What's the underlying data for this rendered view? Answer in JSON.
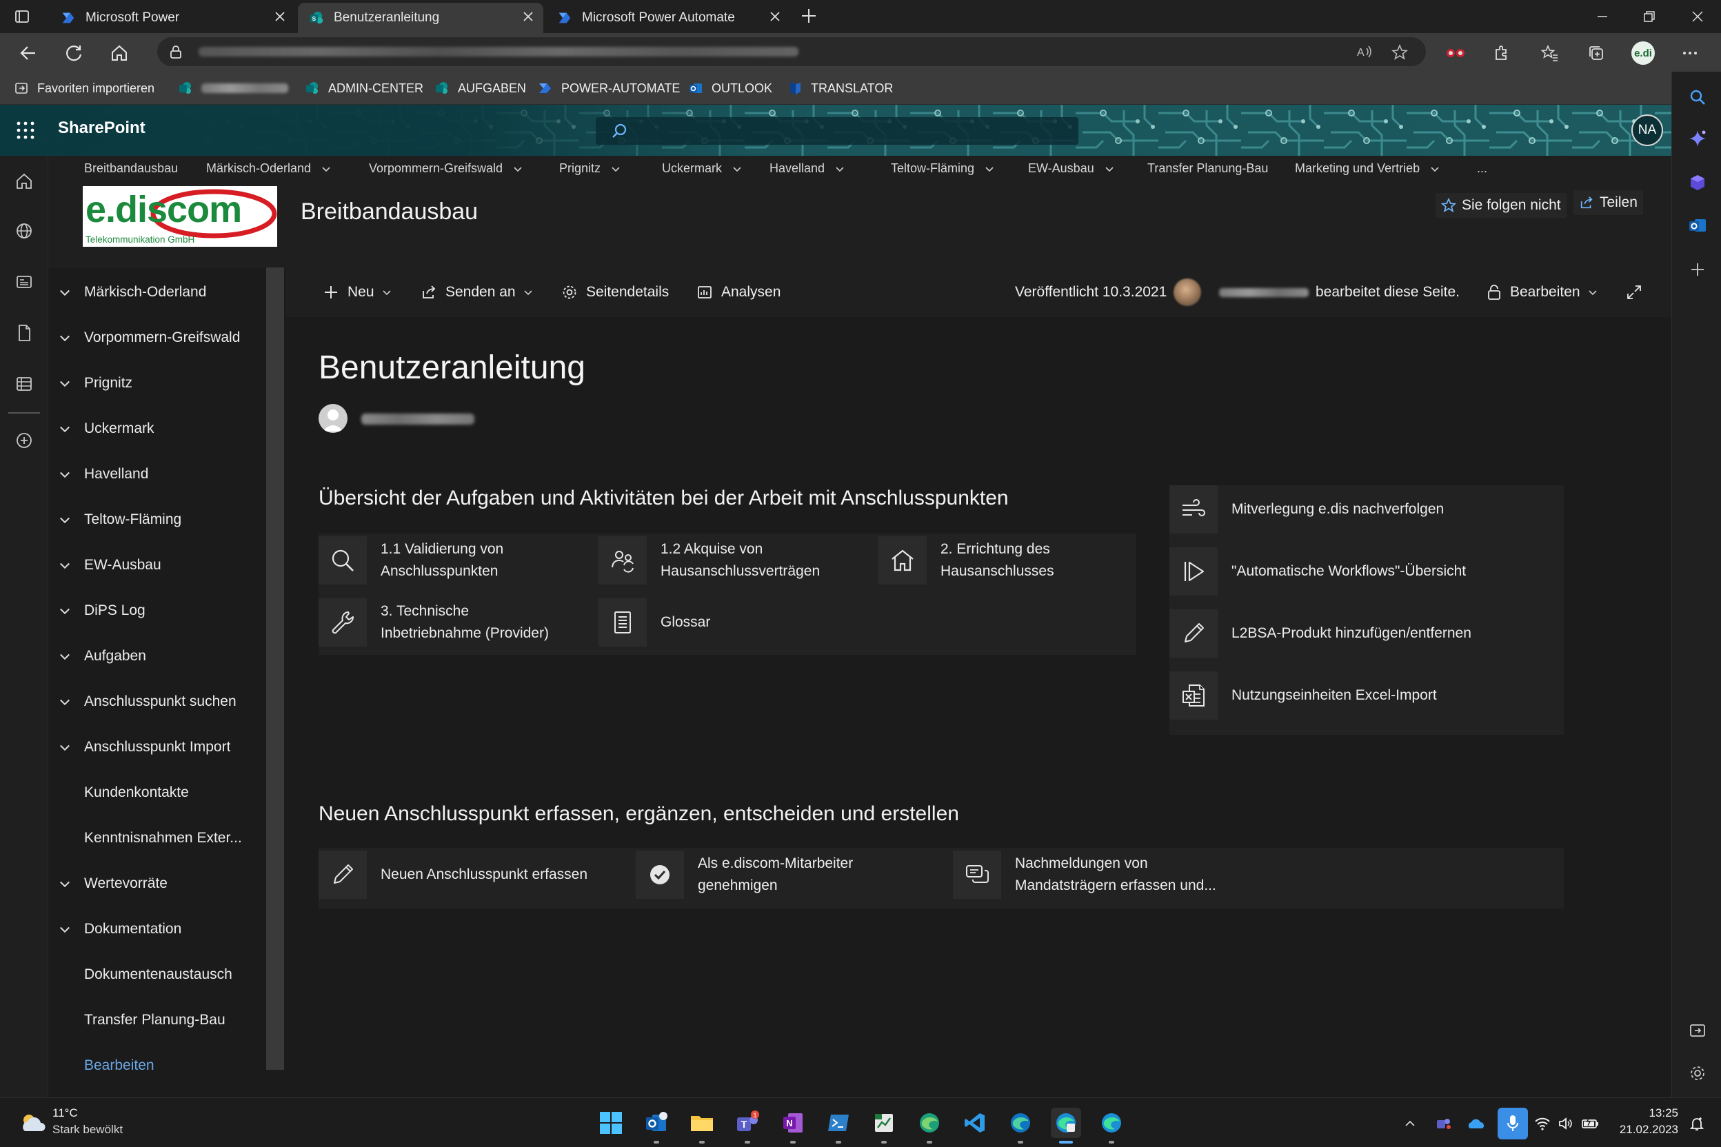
{
  "browser": {
    "tabs": [
      {
        "title": "Microsoft Power Automate",
        "active": false
      },
      {
        "title": "Benutzeranleitung",
        "active": true
      },
      {
        "title": "Microsoft Power Automate",
        "active": false
      }
    ],
    "favorites": [
      {
        "label": "Favoriten importieren",
        "icon": "import-favorites-icon"
      },
      {
        "label": "",
        "icon": "sharepoint-icon",
        "redacted": true
      },
      {
        "label": "ADMIN-CENTER",
        "icon": "sharepoint-icon"
      },
      {
        "label": "AUFGABEN",
        "icon": "sharepoint-icon"
      },
      {
        "label": "POWER-AUTOMATE",
        "icon": "power-automate-icon"
      },
      {
        "label": "OUTLOOK",
        "icon": "outlook-icon"
      },
      {
        "label": "TRANSLATOR",
        "icon": "translator-icon"
      }
    ],
    "profile_initials": "e.di"
  },
  "suite": {
    "app_name": "SharePoint",
    "user_initials": "NA"
  },
  "hubnav": {
    "items": [
      {
        "label": "Breitbandausbau",
        "dropdown": false
      },
      {
        "label": "Märkisch-Oderland",
        "dropdown": true
      },
      {
        "label": "Vorpommern-Greifswald",
        "dropdown": true
      },
      {
        "label": "Prignitz",
        "dropdown": true
      },
      {
        "label": "Uckermark",
        "dropdown": true
      },
      {
        "label": "Havelland",
        "dropdown": true
      },
      {
        "label": "Teltow-Fläming",
        "dropdown": true
      },
      {
        "label": "EW-Ausbau",
        "dropdown": true
      },
      {
        "label": "Transfer Planung-Bau",
        "dropdown": false
      },
      {
        "label": "Marketing und Vertrieb",
        "dropdown": true
      },
      {
        "label": "...",
        "dropdown": false
      }
    ]
  },
  "site": {
    "logo_text": "e.discom",
    "logo_subtext": "Telekommunikation GmbH",
    "title": "Breitbandausbau",
    "follow_label": "Sie folgen nicht",
    "share_label": "Teilen"
  },
  "quicklaunch": {
    "items": [
      {
        "label": "Märkisch-Oderland",
        "expandable": true
      },
      {
        "label": "Vorpommern-Greifswald",
        "expandable": true
      },
      {
        "label": "Prignitz",
        "expandable": true
      },
      {
        "label": "Uckermark",
        "expandable": true
      },
      {
        "label": "Havelland",
        "expandable": true
      },
      {
        "label": "Teltow-Fläming",
        "expandable": true
      },
      {
        "label": "EW-Ausbau",
        "expandable": true
      },
      {
        "label": "DiPS Log",
        "expandable": true
      },
      {
        "label": "Aufgaben",
        "expandable": true
      },
      {
        "label": "Anschlusspunkt suchen",
        "expandable": true
      },
      {
        "label": "Anschlusspunkt Import",
        "expandable": true
      },
      {
        "label": "Kundenkontakte",
        "expandable": false
      },
      {
        "label": "Kenntnisnahmen Exter...",
        "expandable": false
      },
      {
        "label": "Wertevorräte",
        "expandable": true
      },
      {
        "label": "Dokumentation",
        "expandable": true
      },
      {
        "label": "Dokumentenaustausch",
        "expandable": false
      },
      {
        "label": "Transfer Planung-Bau",
        "expandable": false
      },
      {
        "label": "Bearbeiten",
        "expandable": false,
        "link": true
      }
    ]
  },
  "commandbar": {
    "new_label": "Neu",
    "send_label": "Senden an",
    "details_label": "Seitendetails",
    "analytics_label": "Analysen",
    "published_label": "Veröffentlicht 10.3.2021",
    "editing_label": "bearbeitet diese Seite.",
    "edit_label": "Bearbeiten"
  },
  "page": {
    "title": "Benutzeranleitung",
    "section1_title": "Übersicht der Aufgaben und Aktivitäten bei der Arbeit mit Anschlusspunkten",
    "section1_links": [
      {
        "line1": "1.1 Validierung von",
        "line2": "Anschlusspunkten",
        "icon": "search-icon"
      },
      {
        "line1": "1.2 Akquise von",
        "line2": "Hausanschlussverträgen",
        "icon": "people-sync-icon"
      },
      {
        "line1": "2. Errichtung des",
        "line2": "Hausanschlusses",
        "icon": "home-icon"
      },
      {
        "line1": "3. Technische",
        "line2": "Inbetriebnahme (Provider)",
        "icon": "wrench-icon"
      },
      {
        "line1": "Glossar",
        "line2": "",
        "icon": "document-list-icon"
      }
    ],
    "side_links": [
      {
        "label": "Mitverlegung e.dis nachverfolgen",
        "icon": "wind-icon"
      },
      {
        "label": "\"Automatische Workflows\"-Übersicht",
        "icon": "play-icon"
      },
      {
        "label": "L2BSA-Produkt hinzufügen/entfernen",
        "icon": "pencil-icon"
      },
      {
        "label": "Nutzungseinheiten Excel-Import",
        "icon": "excel-icon"
      }
    ],
    "section2_title": "Neuen Anschlusspunkt erfassen, ergänzen, entscheiden und erstellen",
    "section2_links": [
      {
        "line1": "Neuen Anschlusspunkt erfassen",
        "line2": "",
        "icon": "pencil-icon"
      },
      {
        "line1": "Als e.discom-Mitarbeiter",
        "line2": "genehmigen",
        "icon": "checkmark-circle-icon"
      },
      {
        "line1": "Nachmeldungen von",
        "line2": "Mandatsträgern erfassen und...",
        "icon": "chat-stack-icon"
      }
    ]
  },
  "taskbar": {
    "weather_temp": "11°C",
    "weather_desc": "Stark bewölkt",
    "time": "13:25",
    "date": "21.02.2023",
    "teams_badge": "1"
  },
  "colors": {
    "accent_link": "#6aa7e6",
    "suite_teal": "#0d3d45",
    "logo_green": "#1b8a3c",
    "logo_red": "#d71d24"
  }
}
